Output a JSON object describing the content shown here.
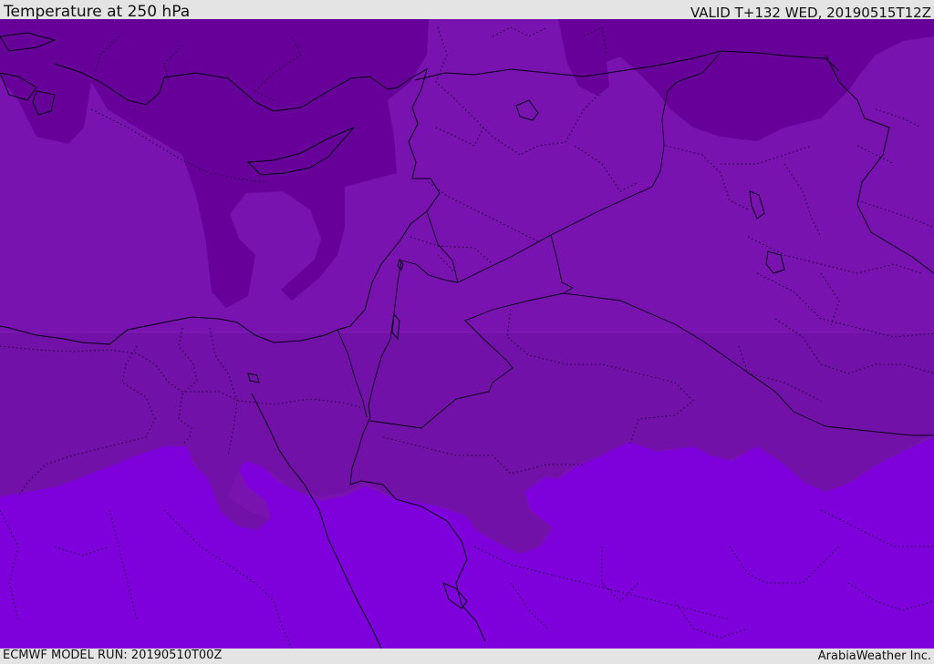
{
  "header": {
    "title": "Temperature at 250 hPa",
    "valid": "VALID T+132 WED, 20190515T12Z"
  },
  "footer": {
    "model_run": "ECMWF MODEL RUN: 20190510T00Z",
    "credit": "ArabiaWeather Inc."
  },
  "map": {
    "field": "temperature",
    "level": "250 hPa",
    "colors": {
      "coldest": "#660099",
      "cold": "#7813b0",
      "mid": "#7211a8",
      "warm": "#7e00db"
    }
  }
}
